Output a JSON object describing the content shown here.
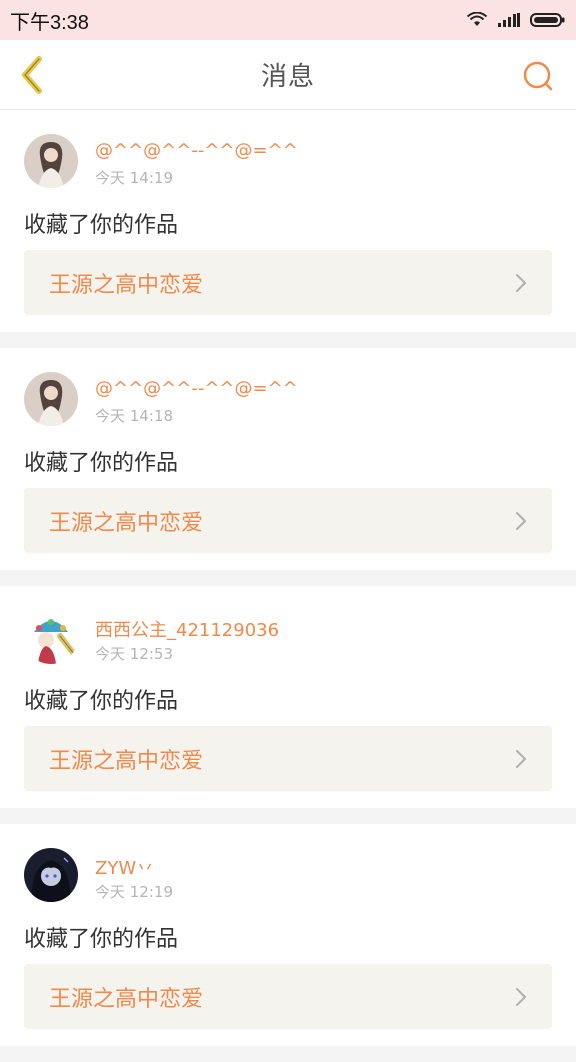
{
  "status_bar": {
    "time": "下午3:38"
  },
  "header": {
    "title": "消息"
  },
  "messages": [
    {
      "username": "@^^@^^--^^@=^^",
      "timestamp": "今天 14:19",
      "action": "收藏了你的作品",
      "work_title": "王源之高中恋爱",
      "avatar_icon": "user-avatar-portrait-a"
    },
    {
      "username": "@^^@^^--^^@=^^",
      "timestamp": "今天 14:18",
      "action": "收藏了你的作品",
      "work_title": "王源之高中恋爱",
      "avatar_icon": "user-avatar-portrait-a"
    },
    {
      "username": "西西公主_421129036",
      "timestamp": "今天 12:53",
      "action": "收藏了你的作品",
      "work_title": "王源之高中恋爱",
      "avatar_icon": "user-avatar-opera"
    },
    {
      "username": "ZYW丷",
      "timestamp": "今天 12:19",
      "action": "收藏了你的作品",
      "work_title": "王源之高中恋爱",
      "avatar_icon": "user-avatar-dark"
    }
  ],
  "colors": {
    "accent": "#f08a4b",
    "status_bar_bg": "#fce3e3",
    "card_link_bg": "#f4f3ee",
    "back_arrow": "#e8c84a"
  }
}
